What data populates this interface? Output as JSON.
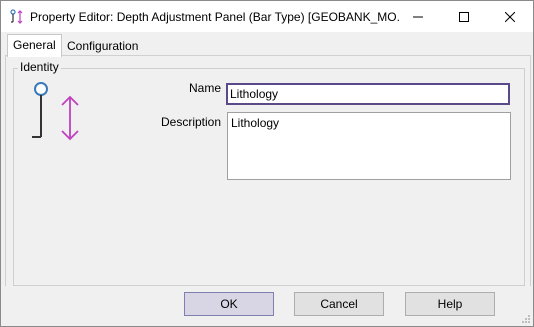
{
  "window": {
    "title": "Property Editor: Depth Adjustment Panel (Bar Type) [GEOBANK_MO..."
  },
  "tabs": [
    {
      "label": "General"
    },
    {
      "label": "Configuration"
    }
  ],
  "identity": {
    "group_label": "Identity",
    "name_label": "Name",
    "name_value": "Lithology",
    "description_label": "Description",
    "description_value": "Lithology"
  },
  "buttons": {
    "ok": "OK",
    "cancel": "Cancel",
    "help": "Help"
  },
  "icons": {
    "app": "depth-adjust-icon",
    "panel": "depth-adjustment-panel-icon",
    "accent": "#c040c0"
  }
}
